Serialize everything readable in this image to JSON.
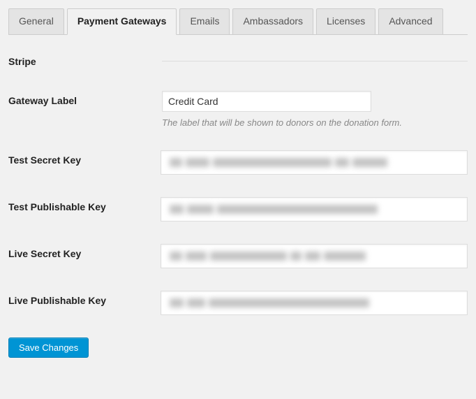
{
  "tabs": [
    {
      "label": "General",
      "active": false
    },
    {
      "label": "Payment Gateways",
      "active": true
    },
    {
      "label": "Emails",
      "active": false
    },
    {
      "label": "Ambassadors",
      "active": false
    },
    {
      "label": "Licenses",
      "active": false
    },
    {
      "label": "Advanced",
      "active": false
    }
  ],
  "section": {
    "title": "Stripe"
  },
  "fields": {
    "gateway_label": {
      "label": "Gateway Label",
      "value": "Credit Card",
      "help": "The label that will be shown to donors on the donation form."
    },
    "test_secret_key": {
      "label": "Test Secret Key",
      "value_redacted": true
    },
    "test_publishable_key": {
      "label": "Test Publishable Key",
      "value_redacted": true
    },
    "live_secret_key": {
      "label": "Live Secret Key",
      "value_redacted": true
    },
    "live_publishable_key": {
      "label": "Live Publishable Key",
      "value_redacted": true
    }
  },
  "actions": {
    "save": "Save Changes"
  }
}
